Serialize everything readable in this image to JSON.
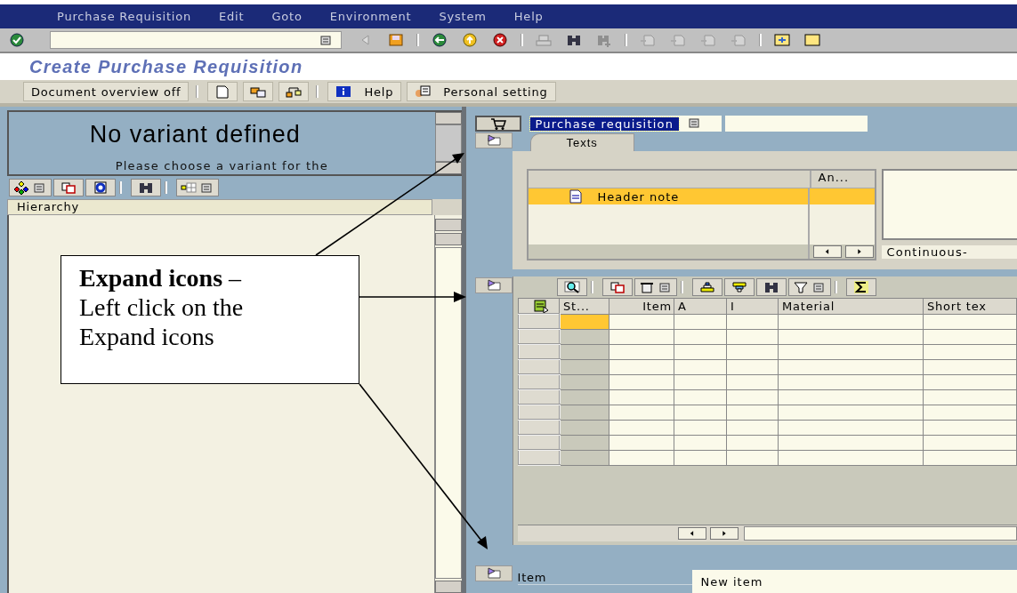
{
  "menu_bar": [
    {
      "label": "Purchase Requisition"
    },
    {
      "label": "Edit"
    },
    {
      "label": "Goto"
    },
    {
      "label": "Environment"
    },
    {
      "label": "System"
    },
    {
      "label": "Help"
    }
  ],
  "standard_toolbar": [
    {
      "kind": "enter",
      "disabled": false
    },
    {
      "kind": "command-field"
    },
    {
      "kind": "left-triangle",
      "disabled": true
    },
    {
      "kind": "save",
      "disabled": false
    },
    {
      "kind": "separator"
    },
    {
      "kind": "back",
      "disabled": false
    },
    {
      "kind": "exit",
      "disabled": false
    },
    {
      "kind": "cancel",
      "disabled": false
    },
    {
      "kind": "separator"
    },
    {
      "kind": "print",
      "disabled": true
    },
    {
      "kind": "find",
      "disabled": false
    },
    {
      "kind": "find-next",
      "disabled": true
    },
    {
      "kind": "separator"
    },
    {
      "kind": "page",
      "disabled": true
    },
    {
      "kind": "page",
      "disabled": true
    },
    {
      "kind": "page",
      "disabled": true
    },
    {
      "kind": "page",
      "disabled": true
    },
    {
      "kind": "separator"
    },
    {
      "kind": "new-session",
      "disabled": false
    },
    {
      "kind": "window",
      "disabled": false
    }
  ],
  "title": "Create Purchase Requisition",
  "application_toolbar": [
    {
      "kind": "text-button",
      "label": "Document overview off"
    },
    {
      "kind": "separator"
    },
    {
      "kind": "document",
      "disabled": false
    },
    {
      "kind": "documents",
      "disabled": false
    },
    {
      "kind": "swap",
      "disabled": false
    },
    {
      "kind": "separator"
    },
    {
      "kind": "info-button",
      "label": "Help"
    },
    {
      "kind": "settings-button",
      "label": "Personal setting"
    }
  ],
  "variant_panel": {
    "title": "No variant defined",
    "text": "Please choose a variant for the"
  },
  "tree_toolbar": [
    {
      "kind": "hierarchy",
      "menu": true,
      "disabled": false
    },
    {
      "kind": "copy",
      "menu": false,
      "disabled": false
    },
    {
      "kind": "refresh",
      "menu": false,
      "disabled": false
    },
    {
      "kind": "separator"
    },
    {
      "kind": "find",
      "menu": false,
      "disabled": false
    },
    {
      "kind": "separator"
    },
    {
      "kind": "layout",
      "menu": true,
      "disabled": false
    }
  ],
  "tree": {
    "column": "Hierarchy"
  },
  "document_header": {
    "field": "Purchase requisition",
    "selected": true
  },
  "tabs": [
    {
      "label": "Texts",
      "selected": true
    }
  ],
  "texts": {
    "column_2": "An...",
    "rows": [
      {
        "label": "Header note",
        "selected": true
      }
    ],
    "editor_format": "Continuous-"
  },
  "items_toolbar": [
    {
      "kind": "details",
      "menu": false,
      "disabled": false
    },
    {
      "kind": "separator"
    },
    {
      "kind": "copy",
      "menu": false,
      "disabled": false
    },
    {
      "kind": "delete",
      "menu": true,
      "disabled": false
    },
    {
      "kind": "separator"
    },
    {
      "kind": "sort-asc",
      "menu": false,
      "disabled": false
    },
    {
      "kind": "sort-desc",
      "menu": false,
      "disabled": false
    },
    {
      "kind": "find",
      "menu": false,
      "disabled": false
    },
    {
      "kind": "filter",
      "menu": true,
      "disabled": false
    },
    {
      "kind": "separator"
    },
    {
      "kind": "sum",
      "menu": false,
      "disabled": false
    }
  ],
  "grid": {
    "columns": [
      "St...",
      "Item",
      "A",
      "I",
      "Material",
      "Short tex"
    ],
    "rows": [
      {
        "focused": true
      },
      {
        "focused": false
      },
      {
        "focused": false
      },
      {
        "focused": false
      },
      {
        "focused": false
      },
      {
        "focused": false
      },
      {
        "focused": false
      },
      {
        "focused": false
      },
      {
        "focused": false
      },
      {
        "focused": false
      }
    ]
  },
  "item_detail": {
    "label": "Item",
    "value": "New item"
  },
  "callout": {
    "text": "**Expand icons** –\nLeft click on the\nExpand icons"
  }
}
